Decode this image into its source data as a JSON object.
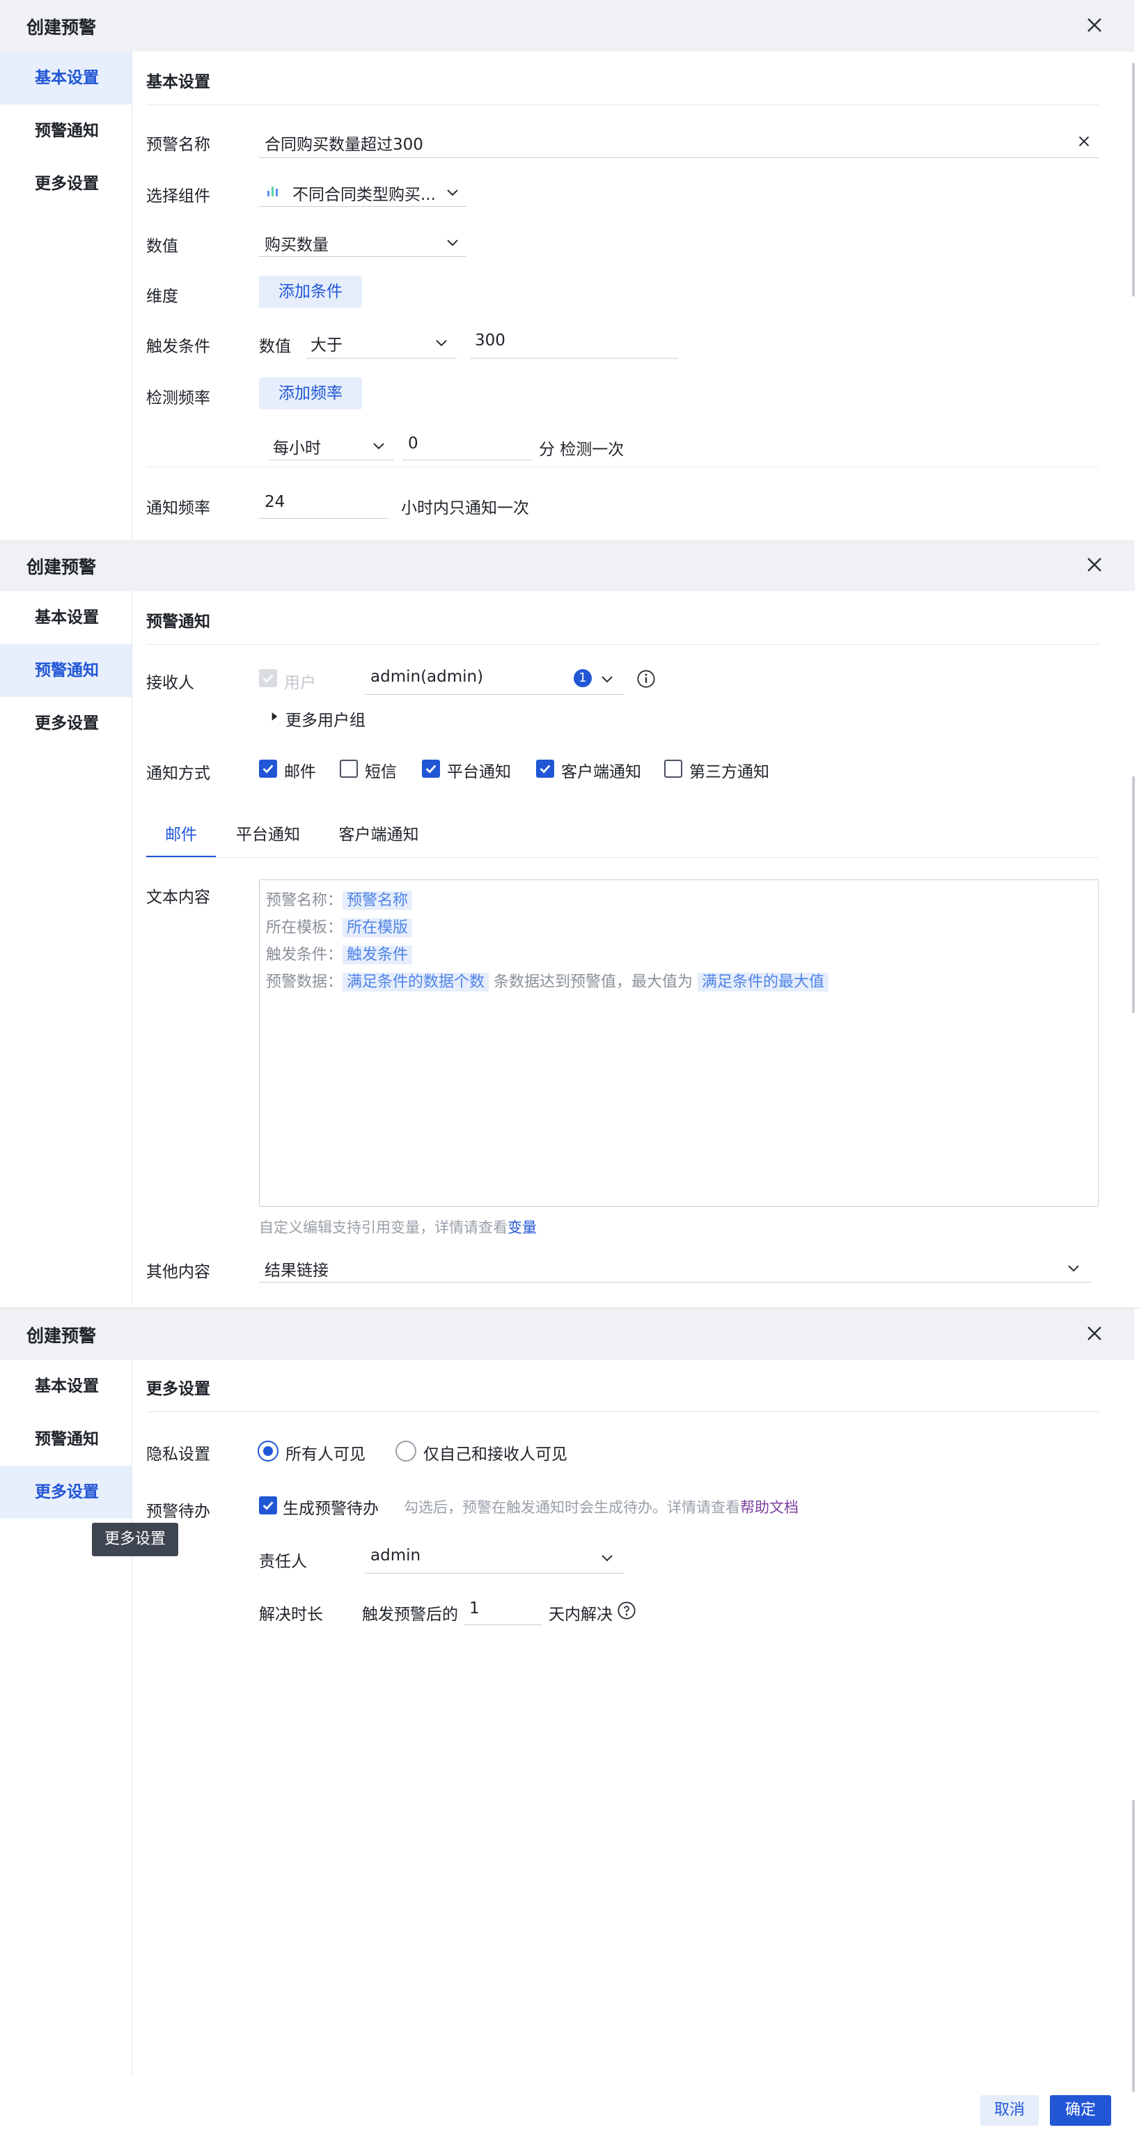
{
  "dialog_title": "创建预警",
  "sidebar": {
    "basic": "基本设置",
    "notify": "预警通知",
    "more": "更多设置"
  },
  "panel1": {
    "section_title": "基本设置",
    "alert_name_label": "预警名称",
    "alert_name_value": "合同购买数量超过300",
    "component_label": "选择组件",
    "component_value": "不同合同类型购买...",
    "value_label": "数值",
    "value_select": "购买数量",
    "dimension_label": "维度",
    "add_condition": "添加条件",
    "trigger_label": "触发条件",
    "trigger_prefix": "数值",
    "trigger_op": "大于",
    "trigger_value": "300",
    "frequency_label": "检测频率",
    "add_frequency": "添加频率",
    "freq_unit": "每小时",
    "freq_minute": "0",
    "freq_suffix": "分 检测一次",
    "notify_freq_label": "通知频率",
    "notify_freq_value": "24",
    "notify_freq_suffix": "小时内只通知一次"
  },
  "panel2": {
    "section_title": "预警通知",
    "receiver_label": "接收人",
    "user_check": "用户",
    "receiver_value": "admin(admin)",
    "receiver_count": "1",
    "more_groups": "更多用户组",
    "method_label": "通知方式",
    "methods": [
      {
        "label": "邮件",
        "checked": true
      },
      {
        "label": "短信",
        "checked": false
      },
      {
        "label": "平台通知",
        "checked": true
      },
      {
        "label": "客户端通知",
        "checked": true
      },
      {
        "label": "第三方通知",
        "checked": false
      }
    ],
    "tabs": [
      "邮件",
      "平台通知",
      "客户端通知"
    ],
    "text_content_label": "文本内容",
    "lines": {
      "l1_key": "预警名称：",
      "l1_tag": "预警名称",
      "l2_key": "所在模板：",
      "l2_tag": "所在模版",
      "l3_key": "触发条件：",
      "l3_tag": "触发条件",
      "l4_key": "预警数据：",
      "l4_tag1": "满足条件的数据个数",
      "l4_mid": "条数据达到预警值，最大值为",
      "l4_tag2": "满足条件的最大值"
    },
    "hint": "自定义编辑支持引用变量，详情请查看",
    "hint_link": "变量",
    "other_label": "其他内容",
    "other_value": "结果链接"
  },
  "panel3": {
    "section_title": "更多设置",
    "privacy_label": "隐私设置",
    "privacy_all": "所有人可见",
    "privacy_self": "仅自己和接收人可见",
    "todo_label": "预警待办",
    "todo_check": "生成预警待办",
    "todo_hint": "勾选后，预警在触发通知时会生成待办。详情请查看",
    "todo_link": "帮助文档",
    "owner_label": "责任人",
    "owner_value": "admin",
    "resolve_label": "解决时长",
    "resolve_prefix": "触发预警后的",
    "resolve_value": "1",
    "resolve_suffix": "天内解决",
    "tooltip": "更多设置",
    "cancel": "取消",
    "confirm": "确定"
  },
  "colors": {
    "accent": "#2156d5",
    "soft": "#e6eefc",
    "header": "#f0f1f4"
  }
}
